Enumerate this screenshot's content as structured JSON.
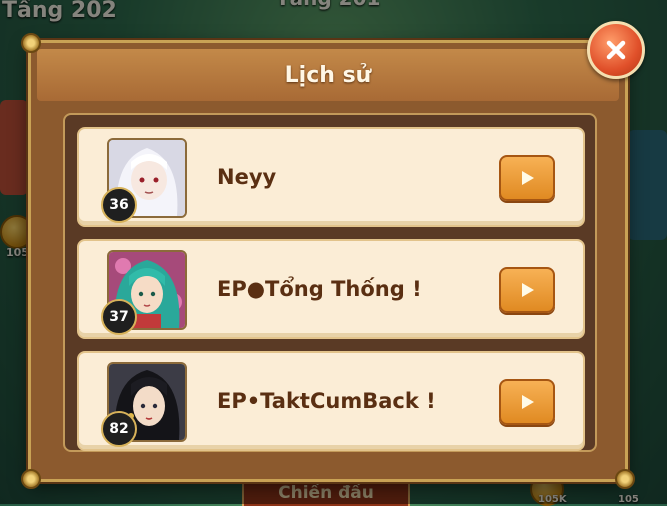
{
  "background": {
    "floor_left": "Tầng 202",
    "floor_top": "Tầng 201",
    "coin_left_amount": "105",
    "coin_right_a": "105K",
    "coin_right_b": "105",
    "fight_button_label": "Chiến đấu"
  },
  "dialog": {
    "title": "Lịch sử",
    "close_icon": "close-x-icon",
    "entries": [
      {
        "level": "36",
        "name": "Neyy",
        "avatar": "white-haired-hero-portrait",
        "play_icon": "play-triangle-icon"
      },
      {
        "level": "37",
        "name": "EP●Tổng Thống !",
        "avatar": "teal-haired-hero-portrait",
        "play_icon": "play-triangle-icon"
      },
      {
        "level": "82",
        "name": "EP•TaktCumBack !",
        "avatar": "black-haired-hero-portrait",
        "play_icon": "play-triangle-icon"
      }
    ]
  },
  "colors": {
    "accent_orange": "#e08a22",
    "dialog_brown": "#8c5a2e",
    "name_text": "#5a2f12",
    "close_red": "#e0502a"
  }
}
